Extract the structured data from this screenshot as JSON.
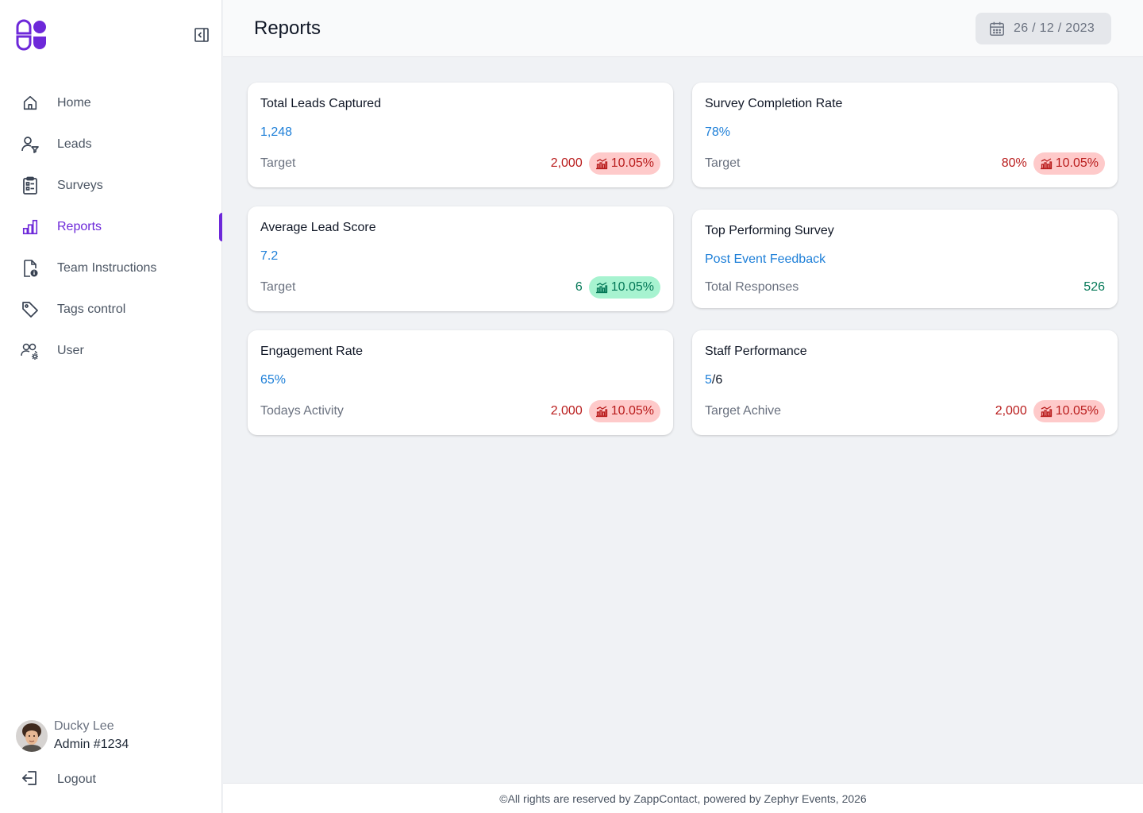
{
  "app": {
    "brand_color": "#6d28d9",
    "accent_blue": "#1d7fd8"
  },
  "sidebar": {
    "items": [
      {
        "label": "Home",
        "icon": "home-icon",
        "active": false
      },
      {
        "label": "Leads",
        "icon": "user-filter-icon",
        "active": false
      },
      {
        "label": "Surveys",
        "icon": "clipboard-list-icon",
        "active": false
      },
      {
        "label": "Reports",
        "icon": "bar-chart-icon",
        "active": true
      },
      {
        "label": "Team Instructions",
        "icon": "document-info-icon",
        "active": false
      },
      {
        "label": "Tags control",
        "icon": "tag-icon",
        "active": false
      },
      {
        "label": "User",
        "icon": "users-gear-icon",
        "active": false
      }
    ],
    "profile": {
      "name": "Ducky Lee",
      "role": "Admin #1234"
    },
    "logout_label": "Logout"
  },
  "header": {
    "title": "Reports",
    "date": "26 / 12 / 2023"
  },
  "cards": [
    {
      "title": "Total Leads Captured",
      "value": "1,248",
      "footer_label": "Target",
      "footer_value": "2,000",
      "badge": "10.05%",
      "status": "negative"
    },
    {
      "title": "Survey Completion Rate",
      "value": "78%",
      "footer_label": "Target",
      "footer_value": "80%",
      "badge": "10.05%",
      "status": "negative"
    },
    {
      "title": "Average Lead Score",
      "value": "7.2",
      "footer_label": "Target",
      "footer_value": "6",
      "badge": "10.05%",
      "status": "positive"
    },
    {
      "title": "Top Performing Survey",
      "value": "Post Event Feedback",
      "footer_label": "Total Responses",
      "footer_value": "526"
    },
    {
      "title": "Engagement Rate",
      "value": "65%",
      "footer_label": "Todays Activity",
      "footer_value": "2,000",
      "badge": "10.05%",
      "status": "negative"
    },
    {
      "title": "Staff Performance",
      "value": "5",
      "value_rest": "/6",
      "footer_label": "Target Achive",
      "footer_value": "2,000",
      "badge": "10.05%",
      "status": "negative"
    }
  ],
  "footer": {
    "text": "©All rights are reserved by ZappContact, powered by Zephyr Events, 2026"
  }
}
